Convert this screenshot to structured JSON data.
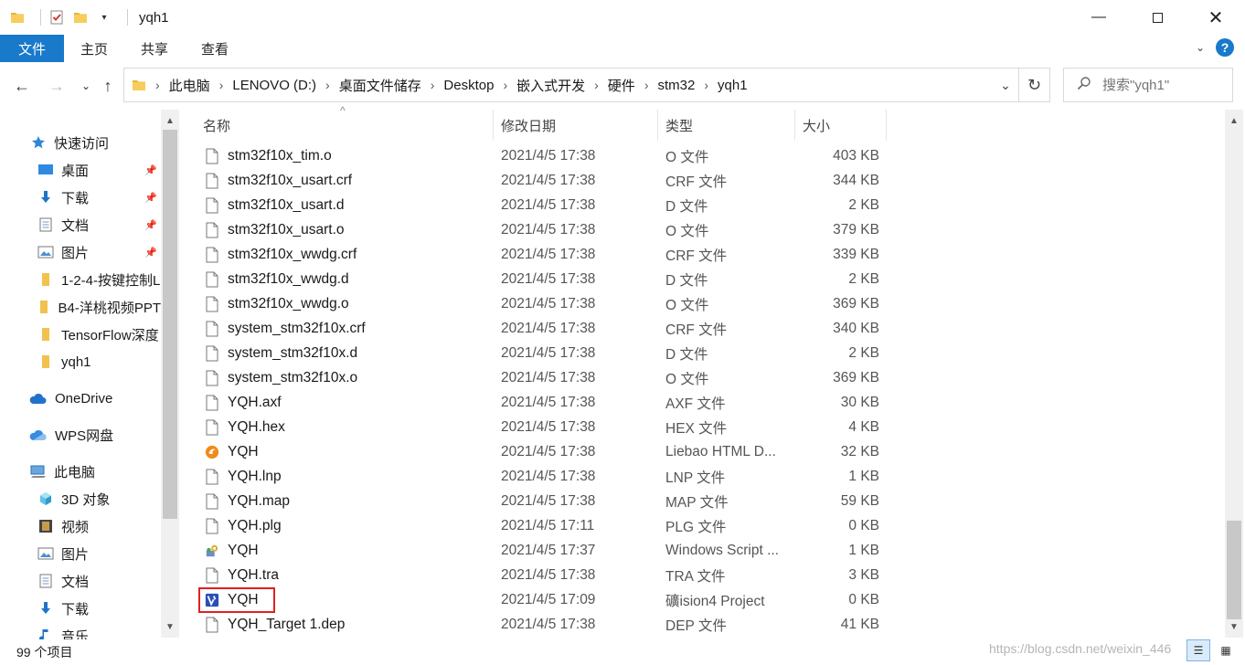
{
  "window": {
    "title": "yqh1"
  },
  "ribbon": {
    "tabs": [
      "文件",
      "主页",
      "共享",
      "查看"
    ]
  },
  "address": {
    "crumbs": [
      "此电脑",
      "LENOVO (D:)",
      "桌面文件储存",
      "Desktop",
      "嵌入式开发",
      "硬件",
      "stm32",
      "yqh1"
    ],
    "search_placeholder": "搜索\"yqh1\""
  },
  "nav": [
    {
      "label": "快速访问",
      "icon": "star-icon",
      "pinned": false
    },
    {
      "label": "桌面",
      "icon": "desktop-icon",
      "pinned": true
    },
    {
      "label": "下载",
      "icon": "download-icon",
      "pinned": true
    },
    {
      "label": "文档",
      "icon": "document-icon",
      "pinned": true
    },
    {
      "label": "图片",
      "icon": "picture-icon",
      "pinned": true
    },
    {
      "label": "1-2-4-按键控制L",
      "icon": "folder-icon",
      "pinned": false
    },
    {
      "label": "B4-洋桃视频PPT",
      "icon": "folder-icon",
      "pinned": false
    },
    {
      "label": "TensorFlow深度",
      "icon": "folder-icon",
      "pinned": false
    },
    {
      "label": "yqh1",
      "icon": "folder-icon",
      "pinned": false
    },
    {
      "label": "OneDrive",
      "icon": "cloud-icon",
      "pinned": false
    },
    {
      "label": "WPS网盘",
      "icon": "wps-cloud-icon",
      "pinned": false
    },
    {
      "label": "此电脑",
      "icon": "computer-icon",
      "pinned": false
    },
    {
      "label": "3D 对象",
      "icon": "cube-icon",
      "pinned": false
    },
    {
      "label": "视频",
      "icon": "video-icon",
      "pinned": false
    },
    {
      "label": "图片",
      "icon": "picture-icon",
      "pinned": false
    },
    {
      "label": "文档",
      "icon": "document-icon",
      "pinned": false
    },
    {
      "label": "下载",
      "icon": "download-icon",
      "pinned": false
    },
    {
      "label": "音乐",
      "icon": "music-icon",
      "pinned": false
    }
  ],
  "columns": {
    "name": "名称",
    "date": "修改日期",
    "type": "类型",
    "size": "大小"
  },
  "files": [
    {
      "name": "stm32f10x_tim.o",
      "date": "2021/4/5 17:38",
      "type": "O 文件",
      "size": "403 KB",
      "icon": "file-icon"
    },
    {
      "name": "stm32f10x_usart.crf",
      "date": "2021/4/5 17:38",
      "type": "CRF 文件",
      "size": "344 KB",
      "icon": "file-icon"
    },
    {
      "name": "stm32f10x_usart.d",
      "date": "2021/4/5 17:38",
      "type": "D 文件",
      "size": "2 KB",
      "icon": "file-icon"
    },
    {
      "name": "stm32f10x_usart.o",
      "date": "2021/4/5 17:38",
      "type": "O 文件",
      "size": "379 KB",
      "icon": "file-icon"
    },
    {
      "name": "stm32f10x_wwdg.crf",
      "date": "2021/4/5 17:38",
      "type": "CRF 文件",
      "size": "339 KB",
      "icon": "file-icon"
    },
    {
      "name": "stm32f10x_wwdg.d",
      "date": "2021/4/5 17:38",
      "type": "D 文件",
      "size": "2 KB",
      "icon": "file-icon"
    },
    {
      "name": "stm32f10x_wwdg.o",
      "date": "2021/4/5 17:38",
      "type": "O 文件",
      "size": "369 KB",
      "icon": "file-icon"
    },
    {
      "name": "system_stm32f10x.crf",
      "date": "2021/4/5 17:38",
      "type": "CRF 文件",
      "size": "340 KB",
      "icon": "file-icon"
    },
    {
      "name": "system_stm32f10x.d",
      "date": "2021/4/5 17:38",
      "type": "D 文件",
      "size": "2 KB",
      "icon": "file-icon"
    },
    {
      "name": "system_stm32f10x.o",
      "date": "2021/4/5 17:38",
      "type": "O 文件",
      "size": "369 KB",
      "icon": "file-icon"
    },
    {
      "name": "YQH.axf",
      "date": "2021/4/5 17:38",
      "type": "AXF 文件",
      "size": "30 KB",
      "icon": "file-icon"
    },
    {
      "name": "YQH.hex",
      "date": "2021/4/5 17:38",
      "type": "HEX 文件",
      "size": "4 KB",
      "icon": "file-icon"
    },
    {
      "name": "YQH",
      "date": "2021/4/5 17:38",
      "type": "Liebao HTML D...",
      "size": "32 KB",
      "icon": "liebao-html-icon"
    },
    {
      "name": "YQH.lnp",
      "date": "2021/4/5 17:38",
      "type": "LNP 文件",
      "size": "1 KB",
      "icon": "file-icon"
    },
    {
      "name": "YQH.map",
      "date": "2021/4/5 17:38",
      "type": "MAP 文件",
      "size": "59 KB",
      "icon": "file-icon"
    },
    {
      "name": "YQH.plg",
      "date": "2021/4/5 17:11",
      "type": "PLG 文件",
      "size": "0 KB",
      "icon": "file-icon"
    },
    {
      "name": "YQH",
      "date": "2021/4/5 17:37",
      "type": "Windows Script ...",
      "size": "1 KB",
      "icon": "windows-script-icon"
    },
    {
      "name": "YQH.tra",
      "date": "2021/4/5 17:38",
      "type": "TRA 文件",
      "size": "3 KB",
      "icon": "file-icon"
    },
    {
      "name": "YQH",
      "date": "2021/4/5 17:09",
      "type": "礦ision4 Project",
      "size": "0 KB",
      "icon": "uvision-project-icon"
    },
    {
      "name": "YQH_Target 1.dep",
      "date": "2021/4/5 17:38",
      "type": "DEP 文件",
      "size": "41 KB",
      "icon": "file-icon"
    }
  ],
  "status": {
    "count": "99 个项目"
  },
  "watermark": "https://blog.csdn.net/weixin_446",
  "colors": {
    "accent": "#1979ca",
    "highlight_box": "#e02020"
  }
}
